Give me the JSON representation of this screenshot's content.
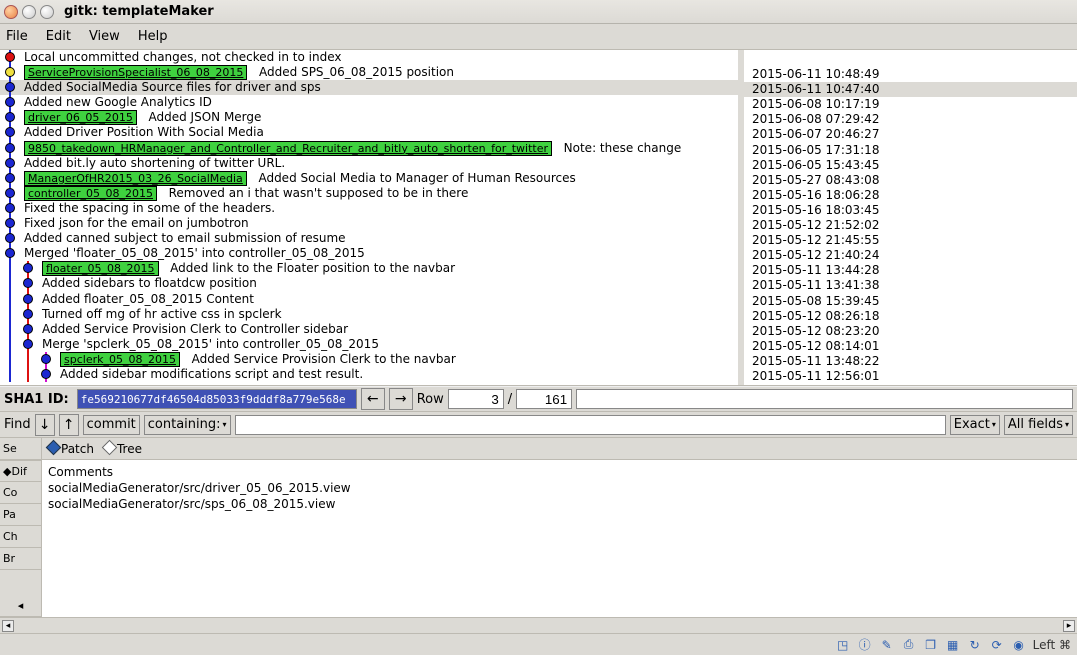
{
  "window": {
    "title": "gitk: templateMaker"
  },
  "menu": {
    "file": "File",
    "edit": "Edit",
    "view": "View",
    "help": "Help"
  },
  "selected_index": 2,
  "commits": [
    {
      "indent": 0,
      "node": "red",
      "branch": null,
      "msg": "Local uncommitted changes, not checked in to index",
      "date": ""
    },
    {
      "indent": 0,
      "node": "yellow",
      "branch": "ServiceProvisionSpecialist_06_08_2015",
      "msg": "Added SPS_06_08_2015 position",
      "date": "2015-06-11 10:48:49"
    },
    {
      "indent": 0,
      "node": "blue",
      "branch": null,
      "msg": "Added SocialMedia Source files for driver and sps",
      "date": "2015-06-11 10:47:40"
    },
    {
      "indent": 0,
      "node": "blue",
      "branch": null,
      "msg": "Added new Google Analytics ID",
      "date": "2015-06-08 10:17:19"
    },
    {
      "indent": 0,
      "node": "blue",
      "branch": "driver_06_05_2015",
      "msg": "Added JSON Merge",
      "date": "2015-06-08 07:29:42"
    },
    {
      "indent": 0,
      "node": "blue",
      "branch": null,
      "msg": "Added Driver Position With Social Media",
      "date": "2015-06-07 20:46:27"
    },
    {
      "indent": 0,
      "node": "blue",
      "branch": "9850_takedown_HRManager_and_Controller_and_Recruiter_and_bitly_auto_shorten_for_twitter",
      "msg": "Note: these change",
      "date": "2015-06-05 17:31:18"
    },
    {
      "indent": 0,
      "node": "blue",
      "branch": null,
      "msg": "Added bit.ly auto shortening of twitter URL.",
      "date": "2015-06-05 15:43:45"
    },
    {
      "indent": 0,
      "node": "blue",
      "branch": "ManagerOfHR2015_03_26_SocialMedia",
      "msg": "Added Social Media to Manager of Human Resources",
      "date": "2015-05-27 08:43:08"
    },
    {
      "indent": 0,
      "node": "blue",
      "branch": "controller_05_08_2015",
      "msg": "Removed an i that wasn't supposed to be in there",
      "date": "2015-05-16 18:06:28"
    },
    {
      "indent": 0,
      "node": "blue",
      "branch": null,
      "msg": "Fixed the spacing in some of the headers.",
      "date": "2015-05-16 18:03:45"
    },
    {
      "indent": 0,
      "node": "blue",
      "branch": null,
      "msg": "Fixed json for the email on jumbotron",
      "date": "2015-05-12 21:52:02"
    },
    {
      "indent": 0,
      "node": "blue",
      "branch": null,
      "msg": "Added canned subject to email submission of resume",
      "date": "2015-05-12 21:45:55"
    },
    {
      "indent": 0,
      "node": "blue",
      "branch": null,
      "msg": "Merged 'floater_05_08_2015' into controller_05_08_2015",
      "date": "2015-05-12 21:40:24"
    },
    {
      "indent": 1,
      "node": "blue",
      "branch": "floater_05_08_2015",
      "msg": "Added link to the Floater position to the navbar",
      "date": "2015-05-11 13:44:28"
    },
    {
      "indent": 1,
      "node": "blue",
      "branch": null,
      "msg": "Added sidebars to floatdcw position",
      "date": "2015-05-11 13:41:38"
    },
    {
      "indent": 1,
      "node": "blue",
      "branch": null,
      "msg": "Added floater_05_08_2015 Content",
      "date": "2015-05-08 15:39:45"
    },
    {
      "indent": 1,
      "node": "blue",
      "branch": null,
      "msg": "Turned off mg of hr active css in  spclerk",
      "date": "2015-05-12 08:26:18"
    },
    {
      "indent": 1,
      "node": "blue",
      "branch": null,
      "msg": "Added Service Provision Clerk to Controller sidebar",
      "date": "2015-05-12 08:23:20"
    },
    {
      "indent": 1,
      "node": "blue",
      "branch": null,
      "msg": "Merge 'spclerk_05_08_2015' into controller_05_08_2015",
      "date": "2015-05-12 08:14:01"
    },
    {
      "indent": 2,
      "node": "blue",
      "branch": "spclerk_05_08_2015",
      "msg": "Added Service Provision Clerk to the navbar",
      "date": "2015-05-11 13:48:22"
    },
    {
      "indent": 2,
      "node": "blue",
      "branch": null,
      "msg": "Added sidebar modifications script and test result.",
      "date": "2015-05-11 12:56:01"
    }
  ],
  "sha": {
    "label": "SHA1 ID:",
    "value": "fe569210677df46504d85033f9dddf8a779e568e",
    "row_label": "Row",
    "row_current": "3",
    "row_sep": "/",
    "row_total": "161"
  },
  "find": {
    "label": "Find",
    "mode": "commit",
    "rule": "containing:",
    "match": "Exact",
    "scope": "All fields"
  },
  "leftstrip": {
    "search": "Se",
    "diff": "Dif",
    "tabs": [
      "Co",
      "Pa",
      "Ch",
      "Br"
    ]
  },
  "patchbar": {
    "patch": "Patch",
    "tree": "Tree"
  },
  "files": {
    "header": "Comments",
    "items": [
      "socialMediaGenerator/src/driver_05_06_2015.view",
      "socialMediaGenerator/src/sps_06_08_2015.view"
    ]
  },
  "status": {
    "left_label": "Left ⌘"
  }
}
